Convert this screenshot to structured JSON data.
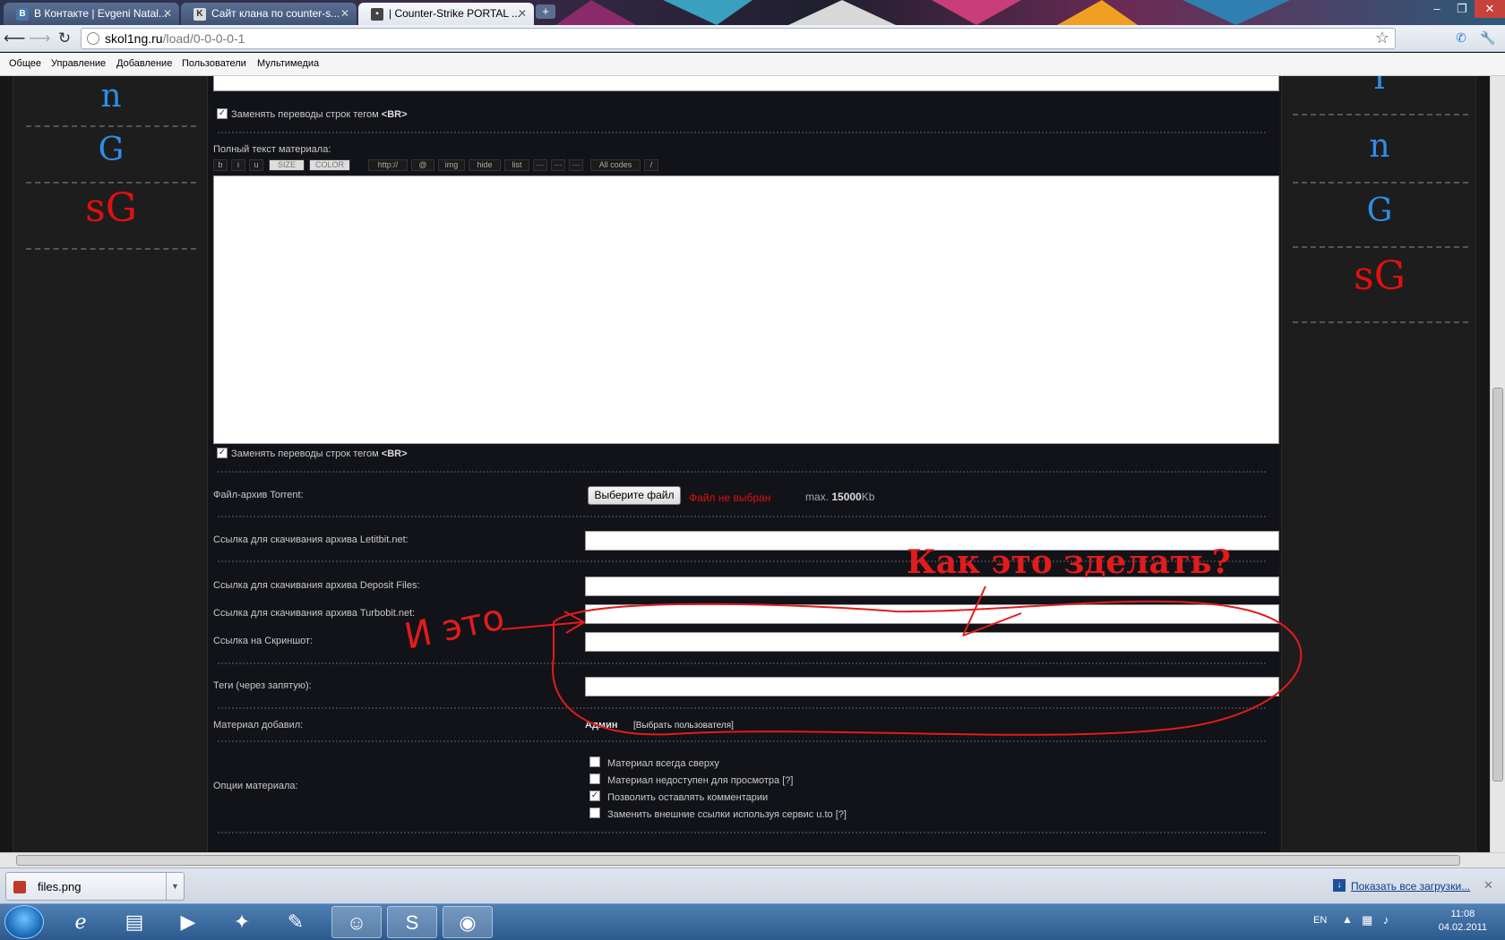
{
  "tabs": [
    {
      "title": "В Контакте | Evgeni Natal...",
      "favicon": "В"
    },
    {
      "title": "Сайт клана по counter-s...",
      "favicon": "K"
    },
    {
      "title": "| Counter-Strike PORTAL ...",
      "favicon": "▪"
    }
  ],
  "new_tab": "+",
  "window_controls": {
    "minimize": "–",
    "maximize": "❐",
    "close": "✕"
  },
  "address": {
    "host": "skol1ng.ru",
    "path": "/load/0-0-0-0-1"
  },
  "bookmarks": [
    "Общее",
    "Управление",
    "Добавление",
    "Пользователи",
    "Мультимедиа"
  ],
  "side_left": [
    "n",
    "G",
    "sG"
  ],
  "side_right": [
    "I",
    "n",
    "G",
    "sG"
  ],
  "colors": {
    "blue_letter": "#2d8ee6",
    "red_letter": "#e01010",
    "annotation": "#e31b1b"
  },
  "form": {
    "br_label_prefix": "Заменять переводы строк тегом ",
    "br_tag": "<BR>",
    "full_text_label": "Полный текст материала:",
    "bbcodes": [
      "b",
      "i",
      "u",
      "SIZE",
      "COLOR",
      "http://",
      "@",
      "img",
      "hide",
      "list",
      "···",
      "···",
      "···",
      "All codes",
      "/"
    ],
    "torrent_label": "Файл-архив Torrent:",
    "choose_file": "Выберите файл",
    "no_file": "Файл не выбран",
    "max_prefix": "max. ",
    "max_value": "15000",
    "max_unit": "Kb",
    "letitbit_label": "Ссылка для скачивания архива Letitbit.net:",
    "deposit_label": "Ссылка для скачивания архива Deposit Files:",
    "turbobit_label": "Ссылка для скачивания архива Turbobit.net:",
    "screenshot_label": "Ссылка на Скриншот:",
    "tags_label": "Теги (через запятую):",
    "added_by_label": "Материал добавил:",
    "added_by_user": "Админ",
    "choose_user": "[Выбрать пользователя]",
    "options_label": "Опции материала:",
    "options": [
      {
        "text": "Материал всегда сверху",
        "checked": false
      },
      {
        "text": "Материал недоступен для просмотра [?]",
        "checked": false
      },
      {
        "text": "Позволить оставлять комментарии",
        "checked": true
      },
      {
        "text": "Заменить внешние ссылки используя сервис u.to [?]",
        "checked": false
      }
    ]
  },
  "annotation": {
    "question": "Как это зделать?",
    "handwritten": "И это"
  },
  "download_shelf": {
    "file": "files.png",
    "show_all": "Показать все загрузки..."
  },
  "tray": {
    "lang": "EN",
    "time": "11:08",
    "date": "04.02.2011"
  }
}
